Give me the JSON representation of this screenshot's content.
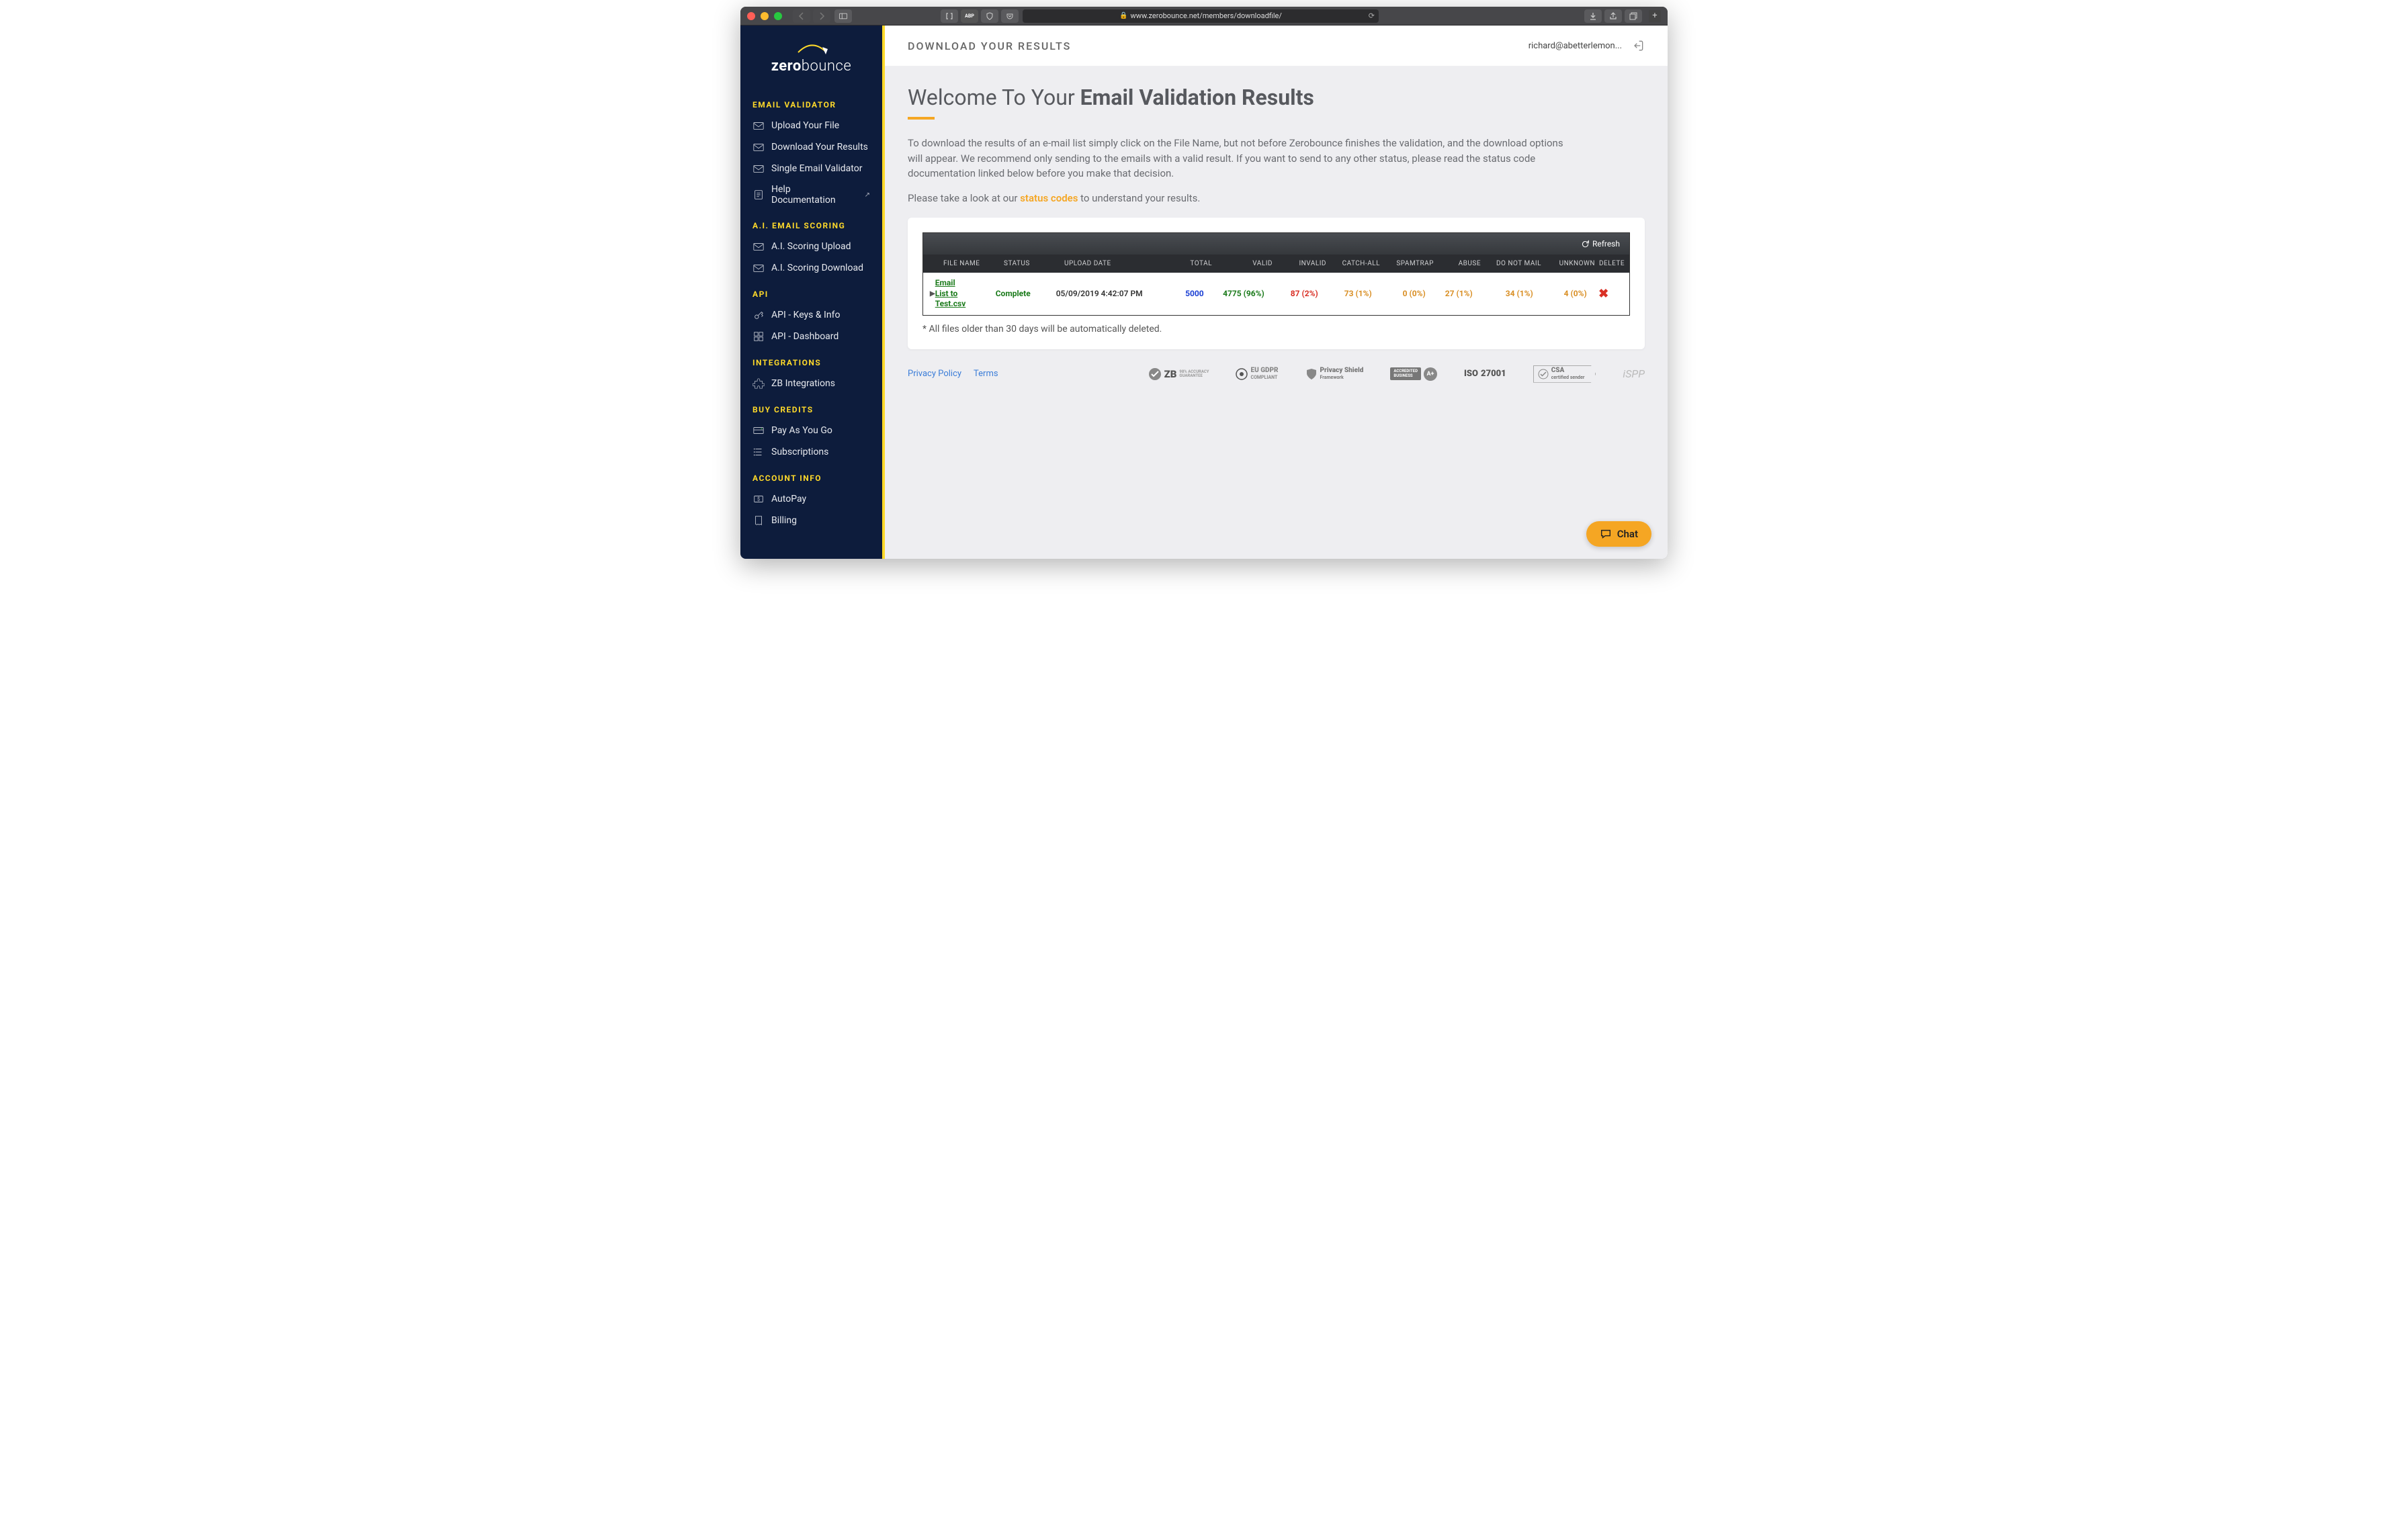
{
  "browser": {
    "url": "www.zerobounce.net/members/downloadfile/"
  },
  "sidebar": {
    "brand_a": "zero",
    "brand_b": "bounce",
    "sections": [
      {
        "title": "EMAIL VALIDATOR",
        "items": [
          "Upload Your File",
          "Download Your Results",
          "Single Email Validator",
          "Help Documentation"
        ]
      },
      {
        "title": "A.I. EMAIL SCORING",
        "items": [
          "A.I. Scoring Upload",
          "A.I. Scoring Download"
        ]
      },
      {
        "title": "API",
        "items": [
          "API - Keys & Info",
          "API - Dashboard"
        ]
      },
      {
        "title": "INTEGRATIONS",
        "items": [
          "ZB Integrations"
        ]
      },
      {
        "title": "BUY CREDITS",
        "items": [
          "Pay As You Go",
          "Subscriptions"
        ]
      },
      {
        "title": "ACCOUNT INFO",
        "items": [
          "AutoPay",
          "Billing"
        ]
      }
    ]
  },
  "topbar": {
    "title": "DOWNLOAD YOUR RESULTS",
    "user": "richard@abetterlemon..."
  },
  "page": {
    "h1_a": "Welcome To Your ",
    "h1_b": "Email Validation Results",
    "para1": "To download the results of an e-mail list simply click on the File Name, but not before Zerobounce finishes the validation, and the download options will appear. We recommend only sending to the emails with a valid result. If you want to send to any other status, please read the status code documentation linked below before you make that decision.",
    "para2_a": "Please take a look at our ",
    "para2_link": "status codes",
    "para2_b": " to understand your results."
  },
  "table": {
    "refresh": "Refresh",
    "headers": {
      "file": "FILE NAME",
      "status": "STATUS",
      "upload": "UPLOAD DATE",
      "total": "TOTAL",
      "valid": "VALID",
      "invalid": "INVALID",
      "catchall": "CATCH-ALL",
      "spam": "SPAMTRAP",
      "abuse": "ABUSE",
      "dnm": "DO NOT MAIL",
      "unknown": "UNKNOWN",
      "delete": "DELETE"
    },
    "row": {
      "file_l1": "Email",
      "file_l2": "List to",
      "file_l3": "Test.csv",
      "status": "Complete",
      "upload": "05/09/2019 4:42:07 PM",
      "total": "5000",
      "valid": "4775 (96%)",
      "invalid": "87 (2%)",
      "catchall": "73 (1%)",
      "spam": "0 (0%)",
      "abuse": "27 (1%)",
      "dnm": "34 (1%)",
      "unknown": "4 (0%)"
    },
    "footnote": "* All files older than 30 days will be automatically deleted."
  },
  "footer": {
    "privacy": "Privacy Policy",
    "terms": "Terms",
    "badges": {
      "zb": "ZB",
      "zb2_a": "98% ACCURACY",
      "zb2_b": "GUARANTEE",
      "gdpr_a": "EU GDPR",
      "gdpr_b": "COMPLIANT",
      "ps_a": "Privacy Shield",
      "ps_b": "Framework",
      "bbb_a": "ACCREDITED",
      "bbb_b": "BUSINESS",
      "bbb_c": "A+",
      "iso": "ISO",
      "iso2": "27001",
      "csa_a": "CSA",
      "csa_b": "certified sender",
      "ispp": "iSPP"
    }
  },
  "chat": "Chat"
}
